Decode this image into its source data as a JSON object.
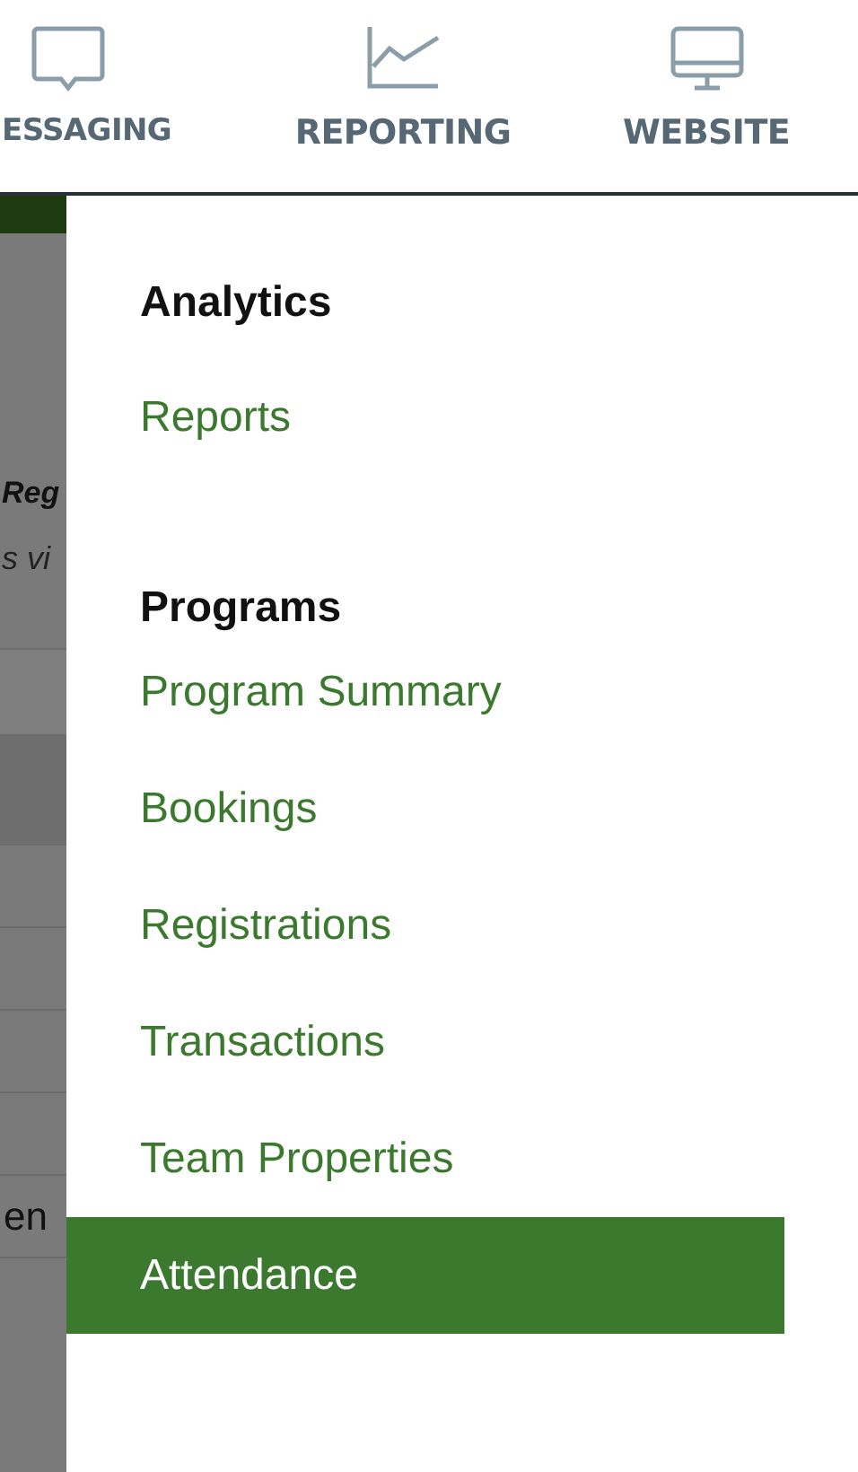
{
  "nav": [
    {
      "label": "ESSAGING"
    },
    {
      "label": "REPORTING"
    },
    {
      "label": "WEBSITE"
    }
  ],
  "background": {
    "heading": "Reg",
    "subtitle": "s vi",
    "cell": "en"
  },
  "menu": [
    {
      "title": "Analytics",
      "items": [
        {
          "label": "Reports",
          "selected": false
        }
      ]
    },
    {
      "title": "Programs",
      "items": [
        {
          "label": "Program Summary",
          "selected": false
        },
        {
          "label": "Bookings",
          "selected": false
        },
        {
          "label": "Registrations",
          "selected": false
        },
        {
          "label": "Transactions",
          "selected": false
        },
        {
          "label": "Team Properties",
          "selected": false
        },
        {
          "label": "Attendance",
          "selected": true
        }
      ]
    }
  ]
}
